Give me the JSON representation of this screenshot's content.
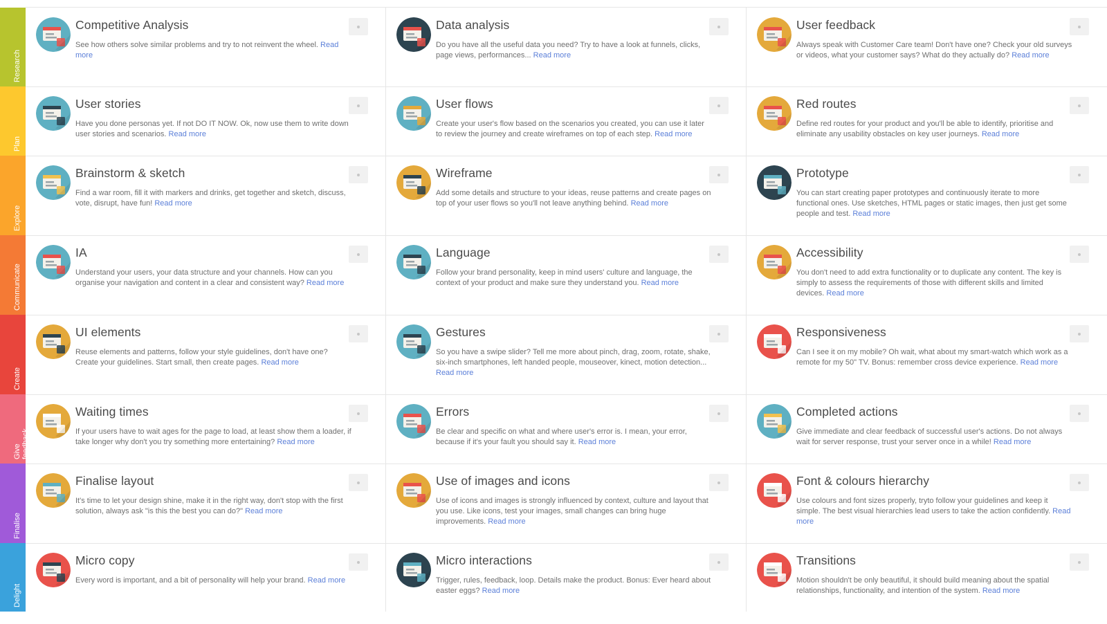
{
  "read_more": "Read more",
  "phases": [
    {
      "label": "Research",
      "color": "#b7c42e"
    },
    {
      "label": "Plan",
      "color": "#fdc82e"
    },
    {
      "label": "Explore",
      "color": "#fba52b"
    },
    {
      "label": "Communicate",
      "color": "#f47a35"
    },
    {
      "label": "Create",
      "color": "#e8453c"
    },
    {
      "label": "Give\nfeedback",
      "color": "#ef6a7d"
    },
    {
      "label": "Finalise",
      "color": "#a05ad9"
    },
    {
      "label": "Delight",
      "color": "#3aa2dc"
    }
  ],
  "rows": [
    [
      {
        "title": "Competitive Analysis",
        "desc": "See how others solve similar problems and try to not reinvent the wheel.",
        "icon": "competitive-analysis-icon",
        "bg": "#5fb0c2",
        "fg": "#e9524b"
      },
      {
        "title": "Data analysis",
        "desc": "Do you have all the useful data you need? Try to have a look at funnels, clicks, page views, performances...",
        "icon": "data-analysis-icon",
        "bg": "#2d4450",
        "fg": "#e9524b"
      },
      {
        "title": "User feedback",
        "desc": "Always speak with Customer Care team! Don't have one? Check your old surveys or videos, what your customer says? What do they actually do?",
        "icon": "user-feedback-icon",
        "bg": "#e4a93b",
        "fg": "#e9524b"
      }
    ],
    [
      {
        "title": "User stories",
        "desc": "Have you done personas yet. If not DO IT NOW. Ok, now use them to write down user stories and scenarios.",
        "icon": "user-stories-icon",
        "bg": "#5fb0c2",
        "fg": "#2d4450"
      },
      {
        "title": "User flows",
        "desc": "Create your user's flow based on the scenarios you created, you can use it later to review the journey and create wireframes on top of each step.",
        "icon": "user-flows-icon",
        "bg": "#5fb0c2",
        "fg": "#e4a93b"
      },
      {
        "title": "Red routes",
        "desc": "Define red routes for your product and you'll be able to identify, prioritise and eliminate any usability obstacles on key user journeys.",
        "icon": "red-routes-icon",
        "bg": "#e4a93b",
        "fg": "#e9524b"
      }
    ],
    [
      {
        "title": "Brainstorm & sketch",
        "desc": "Find a war room, fill it with markers and drinks, get together and sketch, discuss, vote, disrupt, have fun!",
        "icon": "beer-mug-icon",
        "bg": "#5fb0c2",
        "fg": "#f2c14e"
      },
      {
        "title": "Wireframe",
        "desc": "Add some details and structure to your ideas, reuse patterns and create pages on top of your user flows so you'll not leave anything behind.",
        "icon": "wireframe-icon",
        "bg": "#e4a93b",
        "fg": "#2d4450"
      },
      {
        "title": "Prototype",
        "desc": "You can start creating paper prototypes and continuously iterate to more functional ones. Use sketches, HTML pages or static images, then just get some people and test.",
        "icon": "prototype-icon",
        "bg": "#2d4450",
        "fg": "#5fb0c2"
      }
    ],
    [
      {
        "title": "IA",
        "desc": "Understand your users, your data structure and your channels. How can you organise your navigation and content in a clear and consistent way?",
        "icon": "ia-icon",
        "bg": "#5fb0c2",
        "fg": "#e9524b"
      },
      {
        "title": "Language",
        "desc": "Follow your brand personality, keep in mind users' culture and language, the context of your product and make sure they understand you.",
        "icon": "typewriter-icon",
        "bg": "#5fb0c2",
        "fg": "#2d4450"
      },
      {
        "title": "Accessibility",
        "desc": "You don't need to add extra functionality or to duplicate any content. The key is simply to assess the requirements of those with different skills and limited devices.",
        "icon": "accessibility-icon",
        "bg": "#e4a93b",
        "fg": "#e9524b"
      }
    ],
    [
      {
        "title": "UI elements",
        "desc": "Reuse elements and patterns, follow your style guidelines, don't have one? Create your guidelines. Start small, then create pages.",
        "icon": "ui-elements-icon",
        "bg": "#e4a93b",
        "fg": "#2d4450"
      },
      {
        "title": "Gestures",
        "desc": "So you have a swipe slider? Tell me more about pinch, drag, zoom, rotate, shake, six-inch smartphones, left handed people, mouseover, kinect, motion detection...",
        "icon": "smartphone-icon",
        "bg": "#5fb0c2",
        "fg": "#2d4450"
      },
      {
        "title": "Responsiveness",
        "desc": "Can I see it on my mobile? Oh wait, what about my smart-watch which work as a remote for my 50\" TV. Bonus: remember cross device experience.",
        "icon": "responsiveness-icon",
        "bg": "#e9524b",
        "fg": "#ffffff"
      }
    ],
    [
      {
        "title": "Waiting times",
        "desc": "If your users have to wait ages for the page to load, at least show them a loader, if take longer why don't you try something more entertaining?",
        "icon": "plate-icon",
        "bg": "#e4a93b",
        "fg": "#ffffff"
      },
      {
        "title": "Errors",
        "desc": "Be clear and specific on what and where user's error is. I mean, your error, because if it's your fault you should say it.",
        "icon": "errors-icon",
        "bg": "#5fb0c2",
        "fg": "#e9524b"
      },
      {
        "title": "Completed actions",
        "desc": "Give immediate and clear feedback of successful user's actions. Do not always wait for server response, trust your server once in a while!",
        "icon": "thumbs-up-icon",
        "bg": "#5fb0c2",
        "fg": "#f2c14e"
      }
    ],
    [
      {
        "title": "Finalise layout",
        "desc": "It's time to let your design shine, make it in the right way, don't stop with the first solution, always ask \"is this the best you can do?\"",
        "icon": "finalise-layout-icon",
        "bg": "#e4a93b",
        "fg": "#5fb0c2"
      },
      {
        "title": "Use of images and icons",
        "desc": "Use of icons and images is strongly influenced by context, culture and layout that you use. Like icons, test your images, small changes can bring huge improvements.",
        "icon": "shopping-cart-icon",
        "bg": "#e4a93b",
        "fg": "#e9524b"
      },
      {
        "title": "Font & colours hierarchy",
        "desc": "Use colours and font sizes properly, tryto follow your guidelines and keep it simple. The best visual hierarchies lead users to take the action confidently.",
        "icon": "font-hierarchy-icon",
        "bg": "#e9524b",
        "fg": "#ffffff"
      }
    ],
    [
      {
        "title": "Micro copy",
        "desc": "Every word is important, and a bit of personality will help your brand.",
        "icon": "micro-copy-icon",
        "bg": "#e9524b",
        "fg": "#2d4450"
      },
      {
        "title": "Micro interactions",
        "desc": "Trigger, rules, feedback, loop. Details make the product. Bonus: Ever heard about easter eggs?",
        "icon": "magnifier-icon",
        "bg": "#2d4450",
        "fg": "#5fb0c2"
      },
      {
        "title": "Transitions",
        "desc": "Motion shouldn't be only beautiful, it should build meaning about the spatial relationships, functionality, and intention of the system.",
        "icon": "transitions-icon",
        "bg": "#e9524b",
        "fg": "#ffffff"
      }
    ]
  ]
}
